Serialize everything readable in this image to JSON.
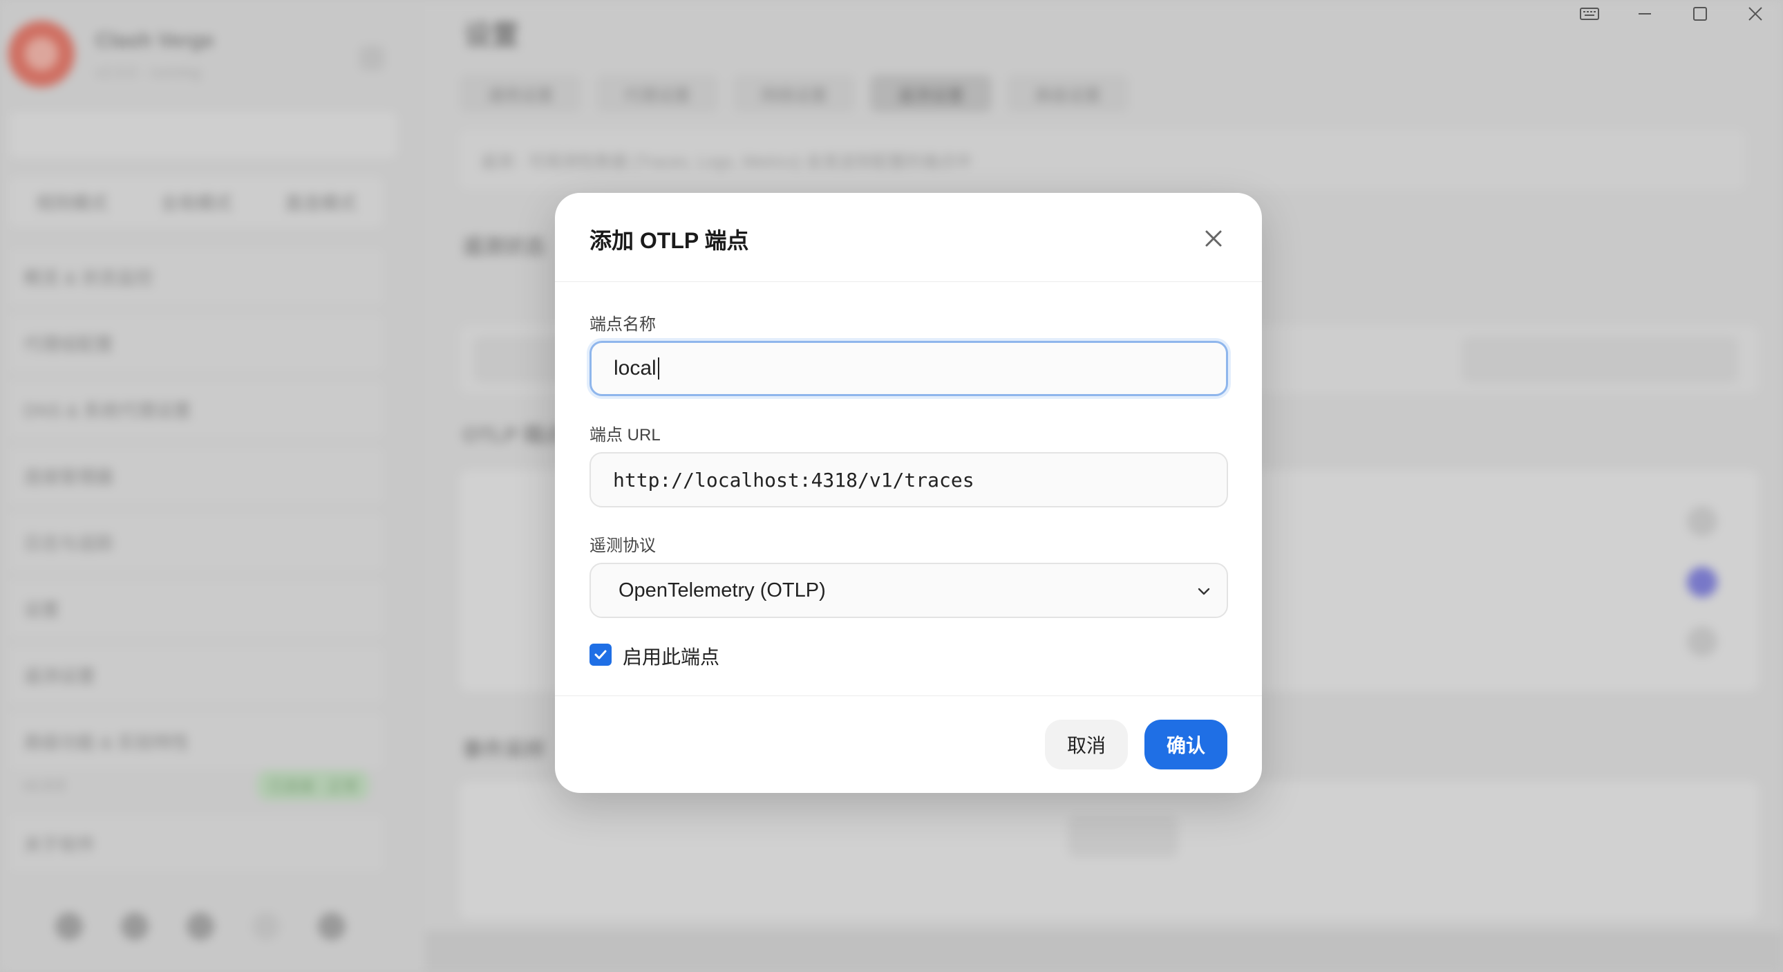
{
  "background": {
    "app_name": "Clash Verge",
    "app_subtitle": "v2.0.0 · running",
    "sidebar_tabs": [
      "规则模式",
      "全局模式",
      "直连模式"
    ],
    "sidebar_items": [
      "概览 & 状态监控",
      "代理组配置",
      "DNS & 系统代理设置",
      "连接管理器",
      "日志与追踪",
      "设置",
      "遥测设置",
      "高级功能 & 实验特性",
      "关于软件"
    ],
    "status_left": "v1.0.0",
    "status_badge": "已连接 · 正常",
    "page_title": "设置",
    "tabs": [
      "通用设置",
      "代理设置",
      "网络设置",
      "遥测设置",
      "高级设置"
    ],
    "info_text": "遥测 · 可观测性数据 (Traces, Logs, Metrics) 会发送到配置的端点中",
    "section1_title": "遥测状态",
    "section2_title": "OTLP 端点",
    "section3_title": "事件采样"
  },
  "window_controls": {
    "keyboard": "keyboard-icon",
    "minimize": "minimize-icon",
    "maximize": "maximize-icon",
    "close": "close-icon"
  },
  "dialog": {
    "title": "添加 OTLP 端点",
    "name_label": "端点名称",
    "name_value": "local",
    "url_label": "端点 URL",
    "url_value": "http://localhost:4318/v1/traces",
    "protocol_label": "遥测协议",
    "protocol_value": "OpenTelemetry (OTLP)",
    "enable_label": "启用此端点",
    "enabled": true,
    "cancel_label": "取消",
    "confirm_label": "确认",
    "accent": "#1f6fe5"
  }
}
